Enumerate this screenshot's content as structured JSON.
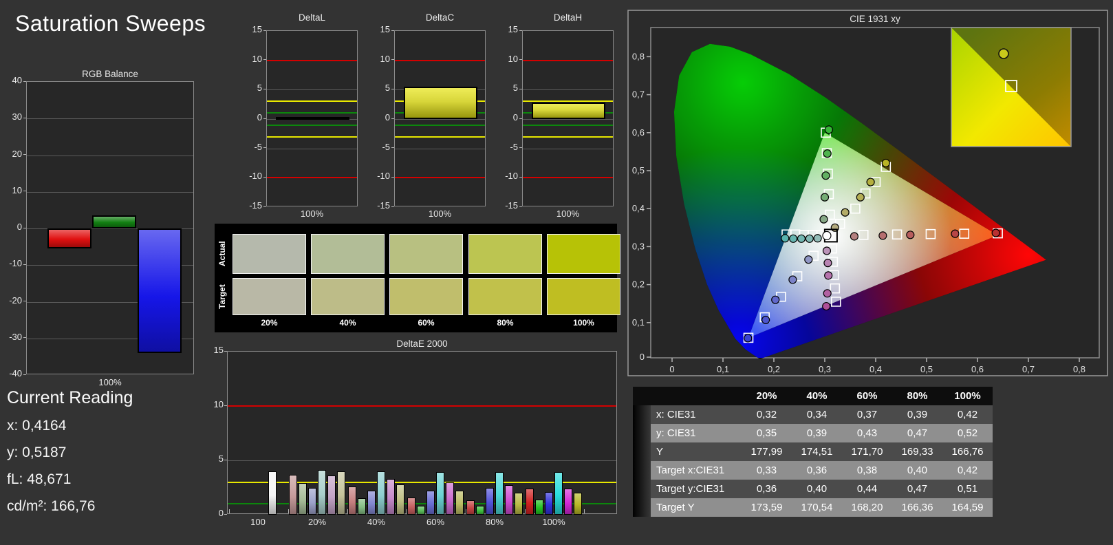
{
  "page": {
    "title": "Saturation Sweeps",
    "background": "#333333"
  },
  "current_reading": {
    "title": "Current Reading",
    "lines": [
      "x: 0,4164",
      "y: 0,5187",
      "fL: 48,671",
      "cd/m²: 166,76"
    ]
  },
  "chart_data": [
    {
      "id": "rgb_balance",
      "type": "bar",
      "title": "RGB Balance",
      "xlabel": "100%",
      "categories": [
        "Red",
        "Green",
        "Blue"
      ],
      "values": [
        -5.5,
        3.5,
        -34
      ],
      "bar_colors": [
        "#e01010",
        "#128012",
        "#1616e8"
      ],
      "ylim": [
        -40,
        40
      ],
      "ytick_step": 10,
      "grid": true
    },
    {
      "id": "delta_l",
      "type": "bar",
      "title": "DeltaL",
      "xlabel": "100%",
      "categories": [
        "100%"
      ],
      "values": [
        0.3
      ],
      "bar_color": "#d8d63a",
      "ylim": [
        -15,
        15
      ],
      "ytick_step": 5,
      "ref_lines": [
        {
          "y": 10,
          "color": "#d40000"
        },
        {
          "y": 3,
          "color": "#e8e800"
        },
        {
          "y": 1,
          "color": "#0c870c"
        },
        {
          "y": -1,
          "color": "#0c870c"
        },
        {
          "y": -3,
          "color": "#e8e800"
        },
        {
          "y": -10,
          "color": "#d40000"
        }
      ]
    },
    {
      "id": "delta_c",
      "type": "bar",
      "title": "DeltaC",
      "xlabel": "100%",
      "categories": [
        "100%"
      ],
      "values": [
        5.5
      ],
      "bar_color": "#d8d63a",
      "ylim": [
        -15,
        15
      ],
      "ytick_step": 5,
      "ref_lines": [
        {
          "y": 10,
          "color": "#d40000"
        },
        {
          "y": 3,
          "color": "#e8e800"
        },
        {
          "y": 1,
          "color": "#0c870c"
        },
        {
          "y": -1,
          "color": "#0c870c"
        },
        {
          "y": -3,
          "color": "#e8e800"
        },
        {
          "y": -10,
          "color": "#d40000"
        }
      ]
    },
    {
      "id": "delta_h",
      "type": "bar",
      "title": "DeltaH",
      "xlabel": "100%",
      "categories": [
        "100%"
      ],
      "values": [
        2.8
      ],
      "bar_color": "#d8d63a",
      "ylim": [
        -15,
        15
      ],
      "ytick_step": 5,
      "ref_lines": [
        {
          "y": 10,
          "color": "#d40000"
        },
        {
          "y": 3,
          "color": "#e8e800"
        },
        {
          "y": 1,
          "color": "#0c870c"
        },
        {
          "y": -1,
          "color": "#0c870c"
        },
        {
          "y": -3,
          "color": "#e8e800"
        },
        {
          "y": -10,
          "color": "#d40000"
        }
      ]
    },
    {
      "id": "saturation_swatches",
      "type": "table",
      "row_labels": [
        "Actual",
        "Target"
      ],
      "col_labels": [
        "20%",
        "40%",
        "60%",
        "80%",
        "100%"
      ],
      "actual_colors": [
        "#b5b9ac",
        "#b2bd97",
        "#b8c081",
        "#bcc551",
        "#b7c206"
      ],
      "target_colors": [
        "#b9b8a6",
        "#bdbc88",
        "#c0be6c",
        "#c1c14b",
        "#bfbe22"
      ]
    },
    {
      "id": "deltae_2000",
      "type": "bar",
      "title": "DeltaE 2000",
      "ylim": [
        0,
        15
      ],
      "yticks": [
        0,
        5,
        10,
        15
      ],
      "ref_lines": [
        {
          "y": 10,
          "color": "#d40000"
        },
        {
          "y": 3,
          "color": "#e8e800"
        },
        {
          "y": 1,
          "color": "#0c870c"
        }
      ],
      "groups": [
        {
          "label": "100",
          "values": [
            null,
            null,
            null,
            null,
            4.0,
            null
          ],
          "colors": [
            null,
            null,
            null,
            null,
            "#f4f4f4",
            null
          ]
        },
        {
          "label": "20%",
          "values": [
            3.7,
            2.9,
            2.5,
            4.1,
            3.6,
            4.0
          ],
          "colors": [
            "#c59a9a",
            "#a5bb97",
            "#9da2ca",
            "#a9cfcb",
            "#c3a3c6",
            "#c5c39b"
          ]
        },
        {
          "label": "40%",
          "values": [
            2.6,
            1.5,
            2.2,
            4.0,
            3.3,
            2.8
          ],
          "colors": [
            "#c57f7f",
            "#83bd83",
            "#8286cf",
            "#8fd0d0",
            "#c489c9",
            "#bfbf84"
          ]
        },
        {
          "label": "60%",
          "values": [
            1.6,
            0.8,
            2.2,
            3.9,
            3.0,
            2.2
          ],
          "colors": [
            "#c66060",
            "#5cbe5c",
            "#6a6ed4",
            "#6cd4d4",
            "#ca6ccd",
            "#bcbc64"
          ]
        },
        {
          "label": "80%",
          "values": [
            1.3,
            0.8,
            2.5,
            3.9,
            2.7,
            2.0
          ],
          "colors": [
            "#c64343",
            "#3fc13f",
            "#5252d8",
            "#4cd8d8",
            "#cf4cd2",
            "#b9b946"
          ]
        },
        {
          "label": "100%",
          "values": [
            2.4,
            1.4,
            2.1,
            3.9,
            2.4,
            2.0
          ],
          "colors": [
            "#d02222",
            "#22c022",
            "#3232dc",
            "#28dcdc",
            "#d428d6",
            "#b6b626"
          ]
        }
      ]
    },
    {
      "id": "cie_1931",
      "type": "scatter",
      "title": "CIE 1931 xy",
      "xlim": [
        0,
        0.85
      ],
      "ylim": [
        0,
        0.85
      ],
      "xticks": [
        "0",
        "0,1",
        "0,2",
        "0,3",
        "0,4",
        "0,5",
        "0,6",
        "0,7",
        "0,8"
      ],
      "yticks": [
        "0",
        "0,1",
        "0,2",
        "0,3",
        "0,4",
        "0,5",
        "0,6",
        "0,7",
        "0,8"
      ],
      "white_point": {
        "target": [
          0.312,
          0.329
        ],
        "measured": [
          0.304,
          0.329
        ]
      },
      "sweeps": [
        {
          "name": "red",
          "targets": [
            [
              0.376,
              0.331
            ],
            [
              0.442,
              0.332
            ],
            [
              0.508,
              0.333
            ],
            [
              0.574,
              0.334
            ],
            [
              0.64,
              0.335
            ]
          ],
          "measured": [
            [
              0.358,
              0.327
            ],
            [
              0.414,
              0.329
            ],
            [
              0.468,
              0.331
            ],
            [
              0.556,
              0.334
            ],
            [
              0.636,
              0.336
            ]
          ],
          "colors": [
            "#b58181",
            "#b66f6f",
            "#b75d5d",
            "#b74646",
            "#bb3030"
          ]
        },
        {
          "name": "green",
          "targets": [
            [
              0.31,
              0.384
            ],
            [
              0.308,
              0.438
            ],
            [
              0.306,
              0.492
            ],
            [
              0.304,
              0.546
            ],
            [
              0.302,
              0.6
            ]
          ],
          "measured": [
            [
              0.298,
              0.372
            ],
            [
              0.3,
              0.43
            ],
            [
              0.302,
              0.487
            ],
            [
              0.305,
              0.545
            ],
            [
              0.308,
              0.608
            ]
          ],
          "colors": [
            "#86a886",
            "#75ad75",
            "#62b062",
            "#4eb44e",
            "#38b838"
          ]
        },
        {
          "name": "blue",
          "targets": [
            [
              0.278,
              0.276
            ],
            [
              0.246,
              0.222
            ],
            [
              0.214,
              0.168
            ],
            [
              0.182,
              0.114
            ],
            [
              0.15,
              0.06
            ]
          ],
          "measured": [
            [
              0.268,
              0.266
            ],
            [
              0.237,
              0.213
            ],
            [
              0.203,
              0.16
            ],
            [
              0.184,
              0.107
            ],
            [
              0.149,
              0.059
            ]
          ],
          "colors": [
            "#9096c5",
            "#7b82c8",
            "#6168cb",
            "#4d55ce",
            "#3a42d2"
          ]
        },
        {
          "name": "cyan",
          "targets": [
            [
              0.293,
              0.33
            ],
            [
              0.276,
              0.331
            ],
            [
              0.259,
              0.331
            ],
            [
              0.242,
              0.332
            ],
            [
              0.225,
              0.332
            ]
          ],
          "measured": [
            [
              0.286,
              0.322
            ],
            [
              0.27,
              0.321
            ],
            [
              0.254,
              0.321
            ],
            [
              0.238,
              0.321
            ],
            [
              0.222,
              0.322
            ]
          ],
          "colors": [
            "#93bcb8",
            "#83b9b5",
            "#74b7b2",
            "#66b5b0",
            "#58b3ae"
          ]
        },
        {
          "name": "magenta",
          "targets": [
            [
              0.314,
              0.295
            ],
            [
              0.316,
              0.26
            ],
            [
              0.318,
              0.225
            ],
            [
              0.32,
              0.19
            ],
            [
              0.322,
              0.155
            ]
          ],
          "measured": [
            [
              0.304,
              0.289
            ],
            [
              0.306,
              0.257
            ],
            [
              0.307,
              0.224
            ],
            [
              0.305,
              0.177
            ],
            [
              0.303,
              0.143
            ]
          ],
          "colors": [
            "#bb93b8",
            "#b883b2",
            "#b673ac",
            "#b261a2",
            "#ae4f97"
          ]
        },
        {
          "name": "yellow",
          "targets": [
            [
              0.33,
              0.36
            ],
            [
              0.36,
              0.4
            ],
            [
              0.38,
              0.44
            ],
            [
              0.4,
              0.47
            ],
            [
              0.42,
              0.51
            ]
          ],
          "measured": [
            [
              0.32,
              0.35
            ],
            [
              0.34,
              0.39
            ],
            [
              0.37,
              0.43
            ],
            [
              0.39,
              0.47
            ],
            [
              0.42,
              0.52
            ]
          ],
          "colors": [
            "#b3ab7e",
            "#b3ac68",
            "#b4ae55",
            "#b5b03f",
            "#b9b425"
          ]
        }
      ],
      "inset": {
        "measured": [
          0.42,
          0.52
        ],
        "target": [
          0.42,
          0.51
        ]
      }
    }
  ],
  "table": {
    "headers": [
      "20%",
      "40%",
      "60%",
      "80%",
      "100%"
    ],
    "rows": [
      {
        "label": "x: CIE31",
        "values": [
          "0,32",
          "0,34",
          "0,37",
          "0,39",
          "0,42"
        ]
      },
      {
        "label": "y: CIE31",
        "values": [
          "0,35",
          "0,39",
          "0,43",
          "0,47",
          "0,52"
        ]
      },
      {
        "label": "Y",
        "values": [
          "177,99",
          "174,51",
          "171,70",
          "169,33",
          "166,76"
        ]
      },
      {
        "label": "Target x:CIE31",
        "values": [
          "0,33",
          "0,36",
          "0,38",
          "0,40",
          "0,42"
        ]
      },
      {
        "label": "Target y:CIE31",
        "values": [
          "0,36",
          "0,40",
          "0,44",
          "0,47",
          "0,51"
        ]
      },
      {
        "label": "Target Y",
        "values": [
          "173,59",
          "170,54",
          "168,20",
          "166,36",
          "164,59"
        ]
      }
    ]
  }
}
